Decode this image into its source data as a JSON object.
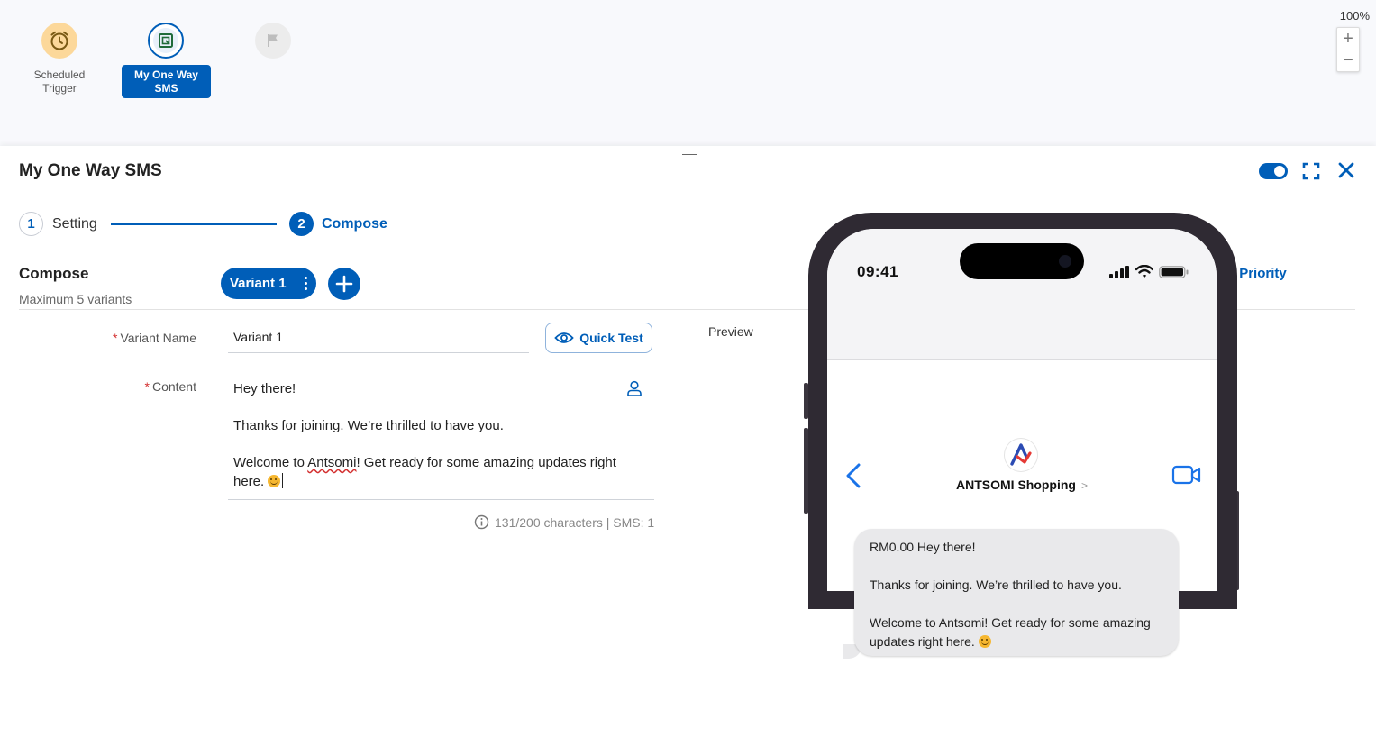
{
  "canvas": {
    "zoom_level": "100%",
    "zoom_in": "+",
    "zoom_out": "−",
    "nodes": [
      {
        "label": "Scheduled Trigger",
        "icon": "clock-icon",
        "color": "#fcd89a"
      },
      {
        "label": "My One Way SMS",
        "icon": "sms-icon",
        "color": "#005eb8"
      },
      {
        "label": "",
        "icon": "flag-icon",
        "color": "#ececec"
      }
    ]
  },
  "drawer": {
    "title": "My One Way SMS",
    "toggle_on": true,
    "accent": "#005eb8"
  },
  "steps": [
    {
      "number": "1",
      "label": "Setting"
    },
    {
      "number": "2",
      "label": "Compose"
    }
  ],
  "compose": {
    "title": "Compose",
    "subtitle": "Maximum 5 variants",
    "variant_label": "Variant 1",
    "variant_priority_label": "Variant Priority"
  },
  "form": {
    "variant_name_label": "Variant Name",
    "variant_name_value": "Variant 1",
    "content_label": "Content",
    "required_mark": "*",
    "quick_test_label": "Quick Test",
    "content_line1": "Hey there!",
    "content_line2": "Thanks for joining. We’re thrilled to have you.",
    "content_line3_before": "Welcome to ",
    "content_line3_misspelled": "Antsomi",
    "content_line3_after": "! Get ready for some amazing updates right here.",
    "char_count": "131/200 characters | SMS: 1"
  },
  "preview": {
    "label": "Preview",
    "time": "09:41",
    "brand_name": "ANTSOMI Shopping",
    "brand_chevron": ">",
    "message_line1": "RM0.00 Hey there!",
    "message_line2": "Thanks for joining. We’re thrilled to have you.",
    "message_line3": "Welcome to Antsomi! Get ready for some amazing updates right here."
  }
}
